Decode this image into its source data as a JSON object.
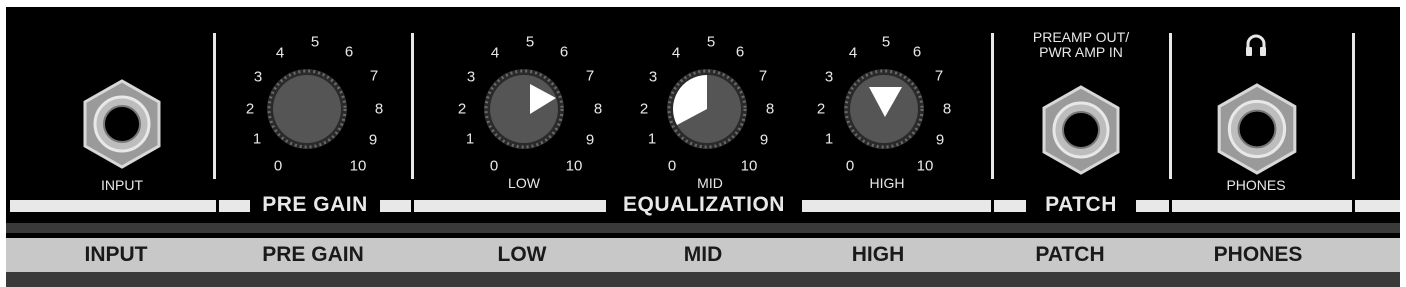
{
  "panel": {
    "input": {
      "label": "INPUT"
    },
    "pre_gain": {
      "title": "PRE GAIN",
      "scale": [
        "0",
        "1",
        "2",
        "3",
        "4",
        "5",
        "6",
        "7",
        "8",
        "9",
        "10"
      ]
    },
    "eq": {
      "title": "EQUALIZATION",
      "low": {
        "label": "LOW",
        "scale": [
          "0",
          "1",
          "2",
          "3",
          "4",
          "5",
          "6",
          "7",
          "8",
          "9",
          "10"
        ]
      },
      "mid": {
        "label": "MID",
        "scale": [
          "0",
          "1",
          "2",
          "3",
          "4",
          "5",
          "6",
          "7",
          "8",
          "9",
          "10"
        ]
      },
      "high": {
        "label": "HIGH",
        "scale": [
          "0",
          "1",
          "2",
          "3",
          "4",
          "5",
          "6",
          "7",
          "8",
          "9",
          "10"
        ]
      }
    },
    "patch": {
      "title": "PATCH",
      "jack_label_line1": "PREAMP OUT/",
      "jack_label_line2": "PWR AMP IN"
    },
    "phones": {
      "label": "PHONES"
    }
  },
  "strip": {
    "labels": [
      "INPUT",
      "PRE GAIN",
      "LOW",
      "MID",
      "HIGH",
      "PATCH",
      "PHONES"
    ]
  },
  "icons": {
    "headphones": "headphones-icon",
    "jack": "jack-socket-icon",
    "knob": "rotary-knob-icon"
  },
  "colors": {
    "panel": "#000000",
    "text": "#e8e8e8",
    "strip": "#c8c8c8",
    "strip_text": "#1a1a1a",
    "knob_face": "#555555",
    "indicator": "#ffffff"
  }
}
